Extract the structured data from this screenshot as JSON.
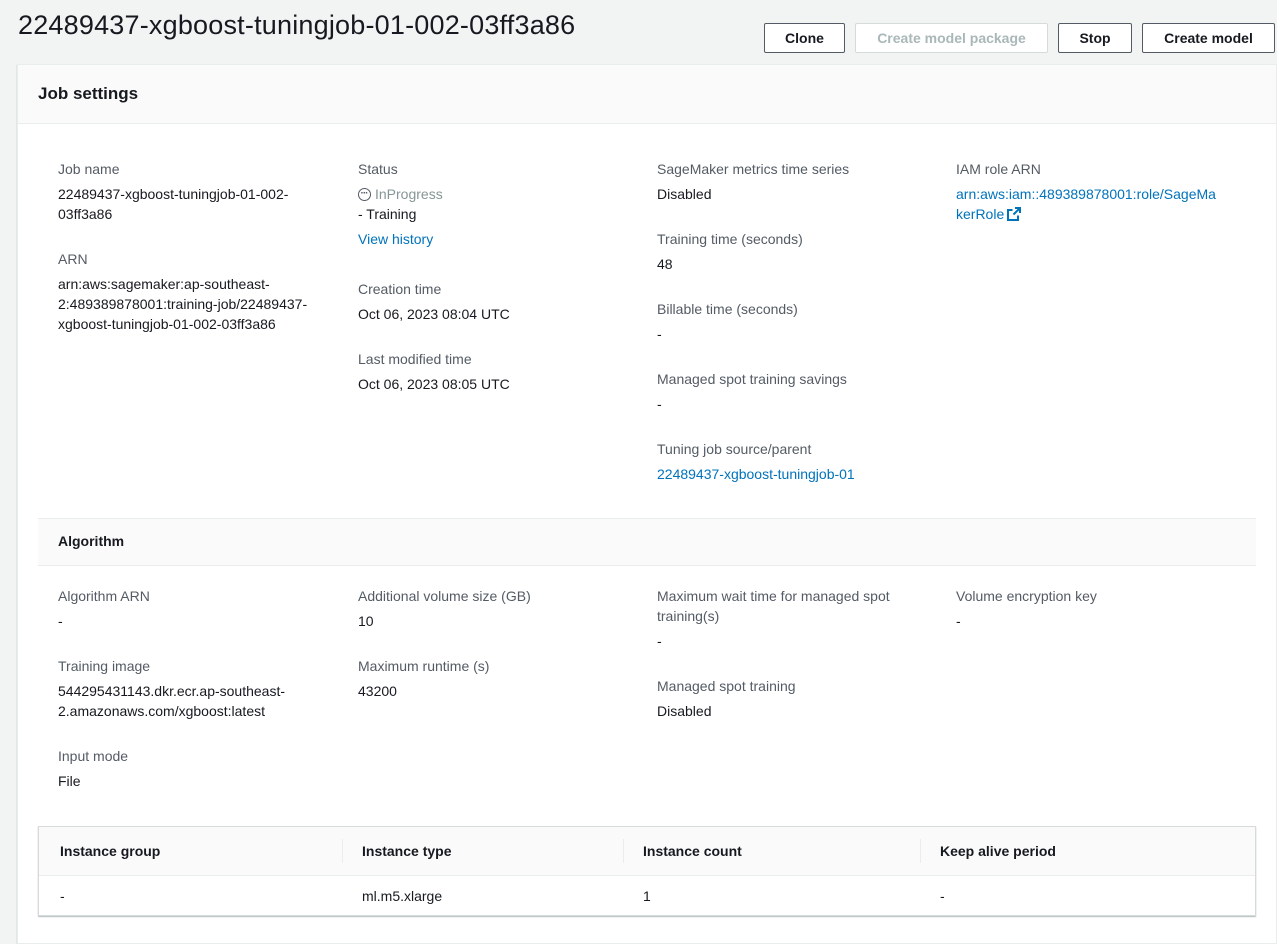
{
  "page": {
    "title": "22489437-xgboost-tuningjob-01-002-03ff3a86"
  },
  "actions": {
    "clone": "Clone",
    "create_model_package": "Create model package",
    "stop": "Stop",
    "create_model": "Create model"
  },
  "job_settings": {
    "title": "Job settings",
    "job_name": {
      "label": "Job name",
      "value_line1": "22489437-xgboost-tuningjob-01-002-",
      "value_line2": "03ff3a86"
    },
    "arn": {
      "label": "ARN",
      "line1": "arn:aws:sagemaker:ap-southeast-",
      "line2": "2:489389878001:training-job/22489437-",
      "line3": "xgboost-tuningjob-01-002-03ff3a86"
    },
    "status": {
      "label": "Status",
      "value": "InProgress",
      "secondary": "- Training",
      "history_link": "View history"
    },
    "creation_time": {
      "label": "Creation time",
      "value": "Oct 06, 2023 08:04 UTC"
    },
    "last_modified_time": {
      "label": "Last modified time",
      "value": "Oct 06, 2023 08:05 UTC"
    },
    "metrics_time_series": {
      "label": "SageMaker metrics time series",
      "value": "Disabled"
    },
    "training_time": {
      "label": "Training time (seconds)",
      "value": "48"
    },
    "billable_time": {
      "label": "Billable time (seconds)",
      "value": "-"
    },
    "spot_savings": {
      "label": "Managed spot training savings",
      "value": "-"
    },
    "tuning_source": {
      "label": "Tuning job source/parent",
      "value": "22489437-xgboost-tuningjob-01"
    },
    "iam_role": {
      "label": "IAM role ARN",
      "line1": "arn:aws:iam::489389878001:role/SageMa",
      "line2": "kerRole"
    }
  },
  "algorithm": {
    "title": "Algorithm",
    "algorithm_arn": {
      "label": "Algorithm ARN",
      "value": "-"
    },
    "training_image": {
      "label": "Training image",
      "line1": "544295431143.dkr.ecr.ap-southeast-",
      "line2": "2.amazonaws.com/xgboost:latest"
    },
    "input_mode": {
      "label": "Input mode",
      "value": "File"
    },
    "volume_size": {
      "label": "Additional volume size (GB)",
      "value": "10"
    },
    "max_runtime": {
      "label": "Maximum runtime (s)",
      "value": "43200"
    },
    "max_wait": {
      "label_line1": "Maximum wait time for managed spot",
      "label_line2": "training(s)",
      "value": "-"
    },
    "managed_spot": {
      "label": "Managed spot training",
      "value": "Disabled"
    },
    "volume_key": {
      "label": "Volume encryption key",
      "value": "-"
    }
  },
  "instance_table": {
    "headers": [
      "Instance group",
      "Instance type",
      "Instance count",
      "Keep alive period"
    ],
    "rows": [
      [
        "-",
        "ml.m5.xlarge",
        "1",
        "-"
      ]
    ]
  }
}
